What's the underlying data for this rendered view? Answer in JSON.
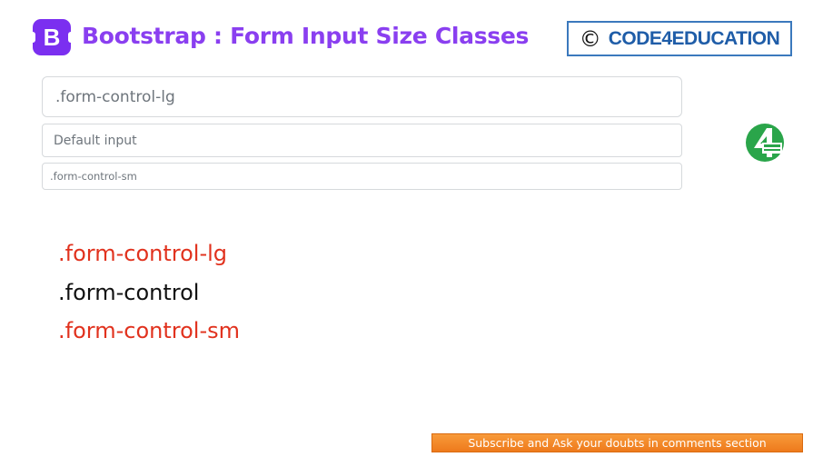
{
  "header": {
    "logo_letter": "B",
    "title": "Bootstrap : Form Input Size Classes",
    "brand_copyright": "©",
    "brand_name": "CODE4EDUCATION"
  },
  "inputs": {
    "large_placeholder": ".form-control-lg",
    "default_placeholder": "Default input",
    "small_placeholder": ".form-control-sm"
  },
  "class_labels": {
    "large": ".form-control-lg",
    "default": ".form-control",
    "small": ".form-control-sm"
  },
  "footer": {
    "subscribe_text": "Subscribe and Ask your doubts in comments section"
  },
  "colors": {
    "bootstrap_purple": "#7b2ff0",
    "title_purple": "#8a3ff0",
    "brand_blue": "#1f5da8",
    "label_red": "#e1321e",
    "subscribe_orange": "#f0821f",
    "logo_green": "#2aa54a"
  },
  "icons": {
    "bootstrap_logo": "bootstrap-logo-icon",
    "channel_logo": "code4education-logo-icon"
  }
}
